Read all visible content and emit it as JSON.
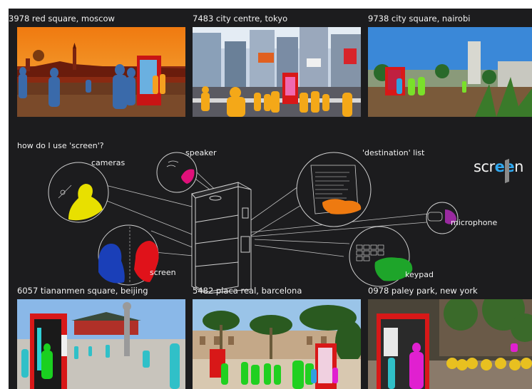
{
  "top_row": [
    {
      "caption": "3978 red square, moscow"
    },
    {
      "caption": "7483 city centre, tokyo"
    },
    {
      "caption": "9738 city square, nairobi"
    }
  ],
  "bottom_row": [
    {
      "caption": "6057 tiananmen square, beijing"
    },
    {
      "caption": "5482 placa real, barcelona"
    },
    {
      "caption": "0978 paley park, new york"
    }
  ],
  "diagram": {
    "heading": "how do I use 'screen'?",
    "logo": {
      "prefix": "scr",
      "e1": "e",
      "e2": "e",
      "suffix": "n"
    },
    "labels": {
      "cameras": "cameras",
      "speaker": "speaker",
      "destination_list": "'destination' list",
      "microphone": "microphone",
      "screen": "screen",
      "keypad": "keypad"
    }
  },
  "colors": {
    "background": "#1c1c1e",
    "camera_highlight": "#e8e000",
    "speaker_highlight": "#e0107a",
    "destination_highlight": "#ee7a10",
    "microphone_highlight": "#9a2aa0",
    "screen_person_a": "#1a3fb8",
    "screen_person_b": "#e0121a",
    "keypad_highlight": "#1ea52a",
    "booth_red": "#d81818"
  }
}
